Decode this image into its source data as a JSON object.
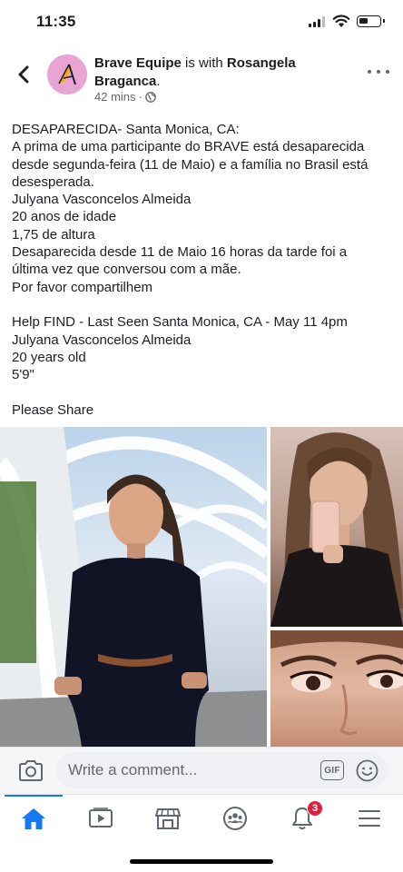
{
  "status_bar": {
    "time": "11:35",
    "battery_level": 0.45
  },
  "header": {
    "page_name": "Brave Equipe",
    "with_text": "is with",
    "tagged_person": "Rosangela Braganca",
    "tagged_suffix": ".",
    "timestamp": "42 mins",
    "separator": "·",
    "privacy_icon": "globe-icon",
    "back_icon": "back-arrow-icon",
    "more_icon": "more-horizontal-icon"
  },
  "post": {
    "lines": [
      "DESAPARECIDA- Santa Monica, CA:",
      "A prima de uma participante do BRAVE está desaparecida",
      "desde segunda-feira (11 de Maio) e a família no Brasil está",
      "desesperada.",
      "Julyana Vasconcelos Almeida",
      "20 anos de idade",
      "1,75 de altura",
      "Desaparecida desde 11 de Maio 16 horas da tarde foi a",
      "última vez que conversou com a mãe.",
      "Por favor compartilhem",
      "",
      "Help FIND - Last Seen Santa Monica, CA - May 11 4pm",
      "Julyana Vasconcelos Almeida",
      "20 years old",
      "5'9\"",
      "",
      "Please Share"
    ]
  },
  "photos": [
    {
      "name": "photo-woman-standing-bridge"
    },
    {
      "name": "photo-mirror-selfie"
    },
    {
      "name": "photo-eyes-closeup"
    }
  ],
  "comment_bar": {
    "placeholder": "Write a comment...",
    "gif_label": "GIF",
    "camera_icon": "camera-icon",
    "emoji_icon": "smiley-icon"
  },
  "tabs": [
    {
      "name": "home",
      "icon": "home-icon",
      "active": true
    },
    {
      "name": "watch",
      "icon": "video-play-icon",
      "active": false
    },
    {
      "name": "marketplace",
      "icon": "shop-icon",
      "active": false
    },
    {
      "name": "groups",
      "icon": "groups-icon",
      "active": false
    },
    {
      "name": "notifications",
      "icon": "bell-icon",
      "active": false,
      "badge": "3"
    },
    {
      "name": "menu",
      "icon": "hamburger-menu-icon",
      "active": false
    }
  ],
  "colors": {
    "accent": "#1877f2",
    "badge": "#e41e3f",
    "text": "#1c1e21",
    "secondary_text": "#65676b"
  }
}
